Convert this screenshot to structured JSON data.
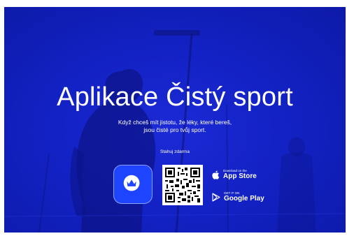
{
  "hero": {
    "title": "Aplikace Čistý sport",
    "subtitle_line1": "Když chceš mít jistotu, že léky, které bereš,",
    "subtitle_line2": "jsou čisté pro tvůj sport.",
    "download_label": "Stahuj zdarma"
  },
  "stores": {
    "apple_small": "Download on the",
    "apple_big": "App Store",
    "google_small": "GET IT ON",
    "google_big": "Google Play"
  },
  "icons": {
    "app": "crown-app-icon",
    "qr": "qr-code",
    "apple": "apple-icon",
    "google": "play-icon"
  },
  "colors": {
    "background": "#1322c4",
    "app_icon": "#1f44ff",
    "text": "#ffffff"
  }
}
